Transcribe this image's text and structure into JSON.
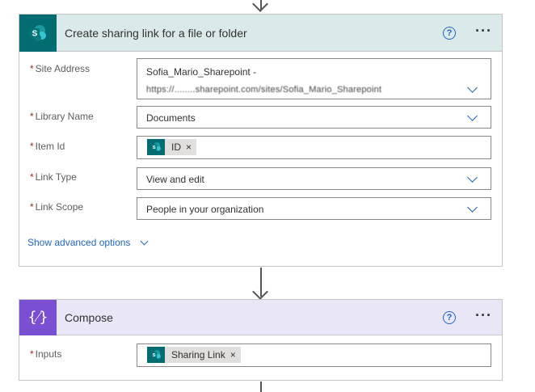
{
  "sharepoint_action": {
    "title": "Create sharing link for a file or folder",
    "help_glyph": "?",
    "more_glyph": "···",
    "fields": {
      "site_address": {
        "label": "Site Address",
        "value": "Sofia_Mario_Sharepoint -",
        "value_line2": "https://........sharepoint.com/sites/Sofia_Mario_Sharepoint"
      },
      "library_name": {
        "label": "Library Name",
        "value": "Documents"
      },
      "item_id": {
        "label": "Item Id",
        "token": "ID",
        "token_remove": "×"
      },
      "link_type": {
        "label": "Link Type",
        "value": "View and edit"
      },
      "link_scope": {
        "label": "Link Scope",
        "value": "People in your organization"
      }
    },
    "required_mark": "*",
    "advanced_options": "Show advanced options"
  },
  "compose_action": {
    "title": "Compose",
    "icon_glyph": "{⁄}",
    "help_glyph": "?",
    "more_glyph": "···",
    "fields": {
      "inputs": {
        "label": "Inputs",
        "token": "Sharing Link",
        "token_remove": "×"
      }
    },
    "required_mark": "*"
  },
  "colors": {
    "sharepoint_brand": "#036c70",
    "sharepoint_header": "#daeaea",
    "compose_brand": "#7a4fd3",
    "compose_header": "#e9e6f7",
    "link_blue": "#2266c2",
    "required_red": "#a4262c"
  }
}
